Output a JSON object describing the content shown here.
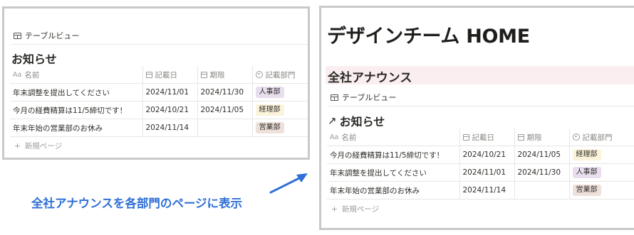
{
  "colors": {
    "caption": "#2f6fd6",
    "arrow": "#2f6fd6",
    "heading_band": "#fbeef0",
    "tag_jinji": "#e8deee",
    "tag_keiri": "#fbf3db",
    "tag_eigyo": "#eee0da"
  },
  "left_panel": {
    "view_label": "テーブルビュー",
    "view_icon": "table-icon",
    "db_title": "お知らせ",
    "columns": [
      {
        "label": "名前",
        "icon": "Aa"
      },
      {
        "label": "記載日",
        "icon": "calendar-icon"
      },
      {
        "label": "期限",
        "icon": "calendar-icon"
      },
      {
        "label": "記載部門",
        "icon": "select-icon"
      }
    ],
    "rows": [
      {
        "name": "年末調整を提出してください",
        "date": "2024/11/01",
        "deadline": "2024/11/30",
        "dept": "人事部"
      },
      {
        "name": "今月の経費精算は11/5締切です！",
        "date": "2024/10/21",
        "deadline": "2024/11/05",
        "dept": "経理部"
      },
      {
        "name": "年末年始の営業部のお休み",
        "date": "2024/11/14",
        "deadline": "",
        "dept": "営業部"
      }
    ],
    "new_page": "新規ページ"
  },
  "right_panel": {
    "page_title": "デザインチーム HOME",
    "section_heading": "全社アナウンス",
    "view_label": "テーブルビュー",
    "view_icon": "table-icon",
    "db_title": "お知らせ",
    "db_title_icon": "arrow-up-right-icon",
    "columns": [
      {
        "label": "名前",
        "icon": "Aa"
      },
      {
        "label": "記載日",
        "icon": "calendar-icon"
      },
      {
        "label": "期限",
        "icon": "calendar-icon"
      },
      {
        "label": "記載部門",
        "icon": "select-icon"
      }
    ],
    "rows": [
      {
        "name": "今月の経費精算は11/5締切です！",
        "date": "2024/10/21",
        "deadline": "2024/11/05",
        "dept": "経理部"
      },
      {
        "name": "年末調整を提出してください",
        "date": "2024/11/01",
        "deadline": "2024/11/30",
        "dept": "人事部"
      },
      {
        "name": "年末年始の営業部のお休み",
        "date": "2024/11/14",
        "deadline": "",
        "dept": "営業部"
      }
    ],
    "new_page": "新規ページ"
  },
  "caption": "全社アナウンスを各部門のページに表示"
}
